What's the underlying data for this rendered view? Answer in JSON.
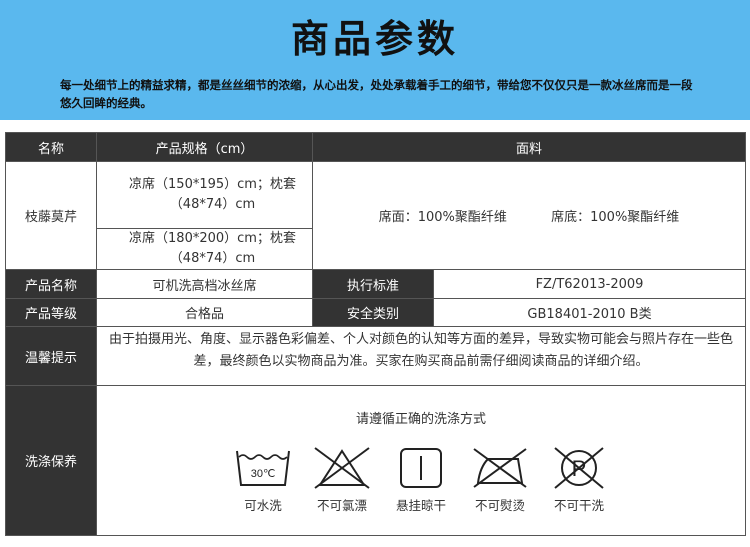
{
  "header": {
    "title": "商品参数",
    "description": "每一处细节上的精益求精，都是丝丝细节的浓缩，从心出发，处处承载着手工的细节，带给您不仅仅只是一款冰丝席而是一段悠久回眸的经典。",
    "bg_color": "#5ab8ee"
  },
  "table": {
    "head": {
      "name": "名称",
      "spec": "产品规格（cm）",
      "fabric": "面料"
    },
    "product_name": "枝藤莫芹",
    "specs": [
      "凉席（150*195）cm；枕套（48*74）cm",
      "凉席（180*200）cm；枕套（48*74）cm"
    ],
    "fabric_top": "席面：100%聚酯纤维",
    "fabric_bottom": "席底：100%聚酯纤维",
    "rows": [
      {
        "label": "产品名称",
        "value": "可机洗高档冰丝席",
        "label2": "执行标准",
        "value2": "FZ/T62013-2009"
      },
      {
        "label": "产品等级",
        "value": "合格品",
        "label2": "安全类别",
        "value2": "GB18401-2010 B类"
      }
    ],
    "warm_label": "温馨提示",
    "warm_text": "由于拍摄用光、角度、显示器色彩偏差、个人对颜色的认知等方面的差异，导致实物可能会与照片存在一些色差，最终颜色以实物商品为准。买家在购买商品前需仔细阅读商品的详细介绍。",
    "wash_label": "洗涤保养",
    "wash_title": "请遵循正确的洗涤方式",
    "wash_icons": [
      {
        "icon": "hand-wash-30-icon",
        "label": "可水洗",
        "temp": "30℃"
      },
      {
        "icon": "no-bleach-icon",
        "label": "不可氯漂"
      },
      {
        "icon": "hang-dry-icon",
        "label": "悬挂晾干"
      },
      {
        "icon": "no-iron-icon",
        "label": "不可熨烫"
      },
      {
        "icon": "no-dry-clean-icon",
        "label": "不可干洗",
        "letter": "P"
      }
    ]
  },
  "colors": {
    "dark_cell": "#333333",
    "border": "#555555"
  }
}
